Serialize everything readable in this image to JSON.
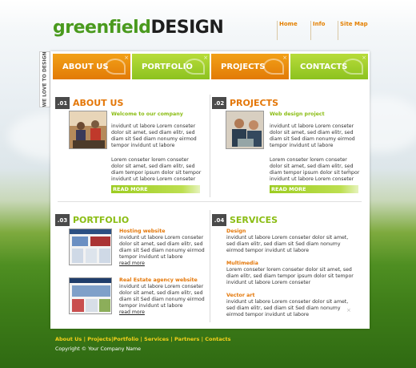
{
  "brand": {
    "logo_green": "greenfield",
    "logo_dark": "DESIGN"
  },
  "top_nav": [
    "Home",
    "Info",
    "Site Map"
  ],
  "side_tag": "WE LOVE TO DESIGN",
  "tabs": [
    "ABOUT US",
    "PORTFOLIO",
    "PROJECTS",
    "CONTACTS"
  ],
  "about": {
    "num": ".01",
    "title": "ABOUT US",
    "subtitle": "Welcome to our company",
    "p1": "invidunt ut labore Lorem conseter dolor sit amet, sed diam elitr, sed diam sit Sed diam nonumy eirmod tempor invidunt ut labore",
    "p2": "Lorem conseter lorem conseter dolor sit amet, sed diam elitr, sed diam tempor ipsum dolor sit tempor invidunt ut labore Lorem conseter",
    "readmore": "READ MORE"
  },
  "projects": {
    "num": ".02",
    "title": "PROJECTS",
    "subtitle": "Web design project",
    "p1": "invidunt ut labore Lorem conseter dolor sit amet, sed diam elitr, sed diam sit Sed diam nonumy eirmod tempor invidunt ut labore",
    "p2": "Lorem conseter lorem conseter dolor sit amet, sed diam elitr, sed diam tempor ipsum dolor sit tempor invidunt ut labore Lorem conseter",
    "readmore": "READ MORE"
  },
  "portfolio": {
    "num": ".03",
    "title": "PORTFOLIO",
    "items": [
      {
        "title": "Hosting website",
        "text": "invidunt ut labore Lorem conseter dolor sit amet, sed diam elitr, sed diam sit Sed diam nonumy eirmod tempor invidunt ut labore",
        "link": "read more"
      },
      {
        "title": "Real Estate agency website",
        "text": "invidunt ut labore Lorem conseter dolor sit amet, sed diam elitr, sed diam sit Sed diam nonumy eirmod tempor invidunt ut labore",
        "link": "read more"
      }
    ]
  },
  "services": {
    "num": ".04",
    "title": "SERVICES",
    "items": [
      {
        "title": "Design",
        "text": "invidunt ut labore Lorem conseter dolor sit amet, sed diam elitr, sed diam sit Sed diam nonumy eirmod tempor invidunt ut labore"
      },
      {
        "title": "Multimedia",
        "text": "Lorem conseter lorem conseter dolor sit amet, sed diam elitr, sed diam tempor ipsum dolor sit tempor invidunt ut labore Lorem conseter"
      },
      {
        "title": "Vector art",
        "text": "invidunt ut labore Lorem conseter dolor sit amet, sed diam elitr, sed diam sit Sed diam nonumy eirmod tempor invidunt ut labore"
      }
    ]
  },
  "footer": {
    "links": [
      "About Us",
      "Projects",
      "Portfolio",
      "Services",
      "Partners",
      "Contacts"
    ],
    "separators": [
      "|",
      "|",
      "|",
      "|",
      "|"
    ],
    "copyright": "Copyright © Your Company Name"
  },
  "colors": {
    "orange": "#e47708",
    "green": "#8bbd14",
    "grass": "#3f7e19"
  }
}
